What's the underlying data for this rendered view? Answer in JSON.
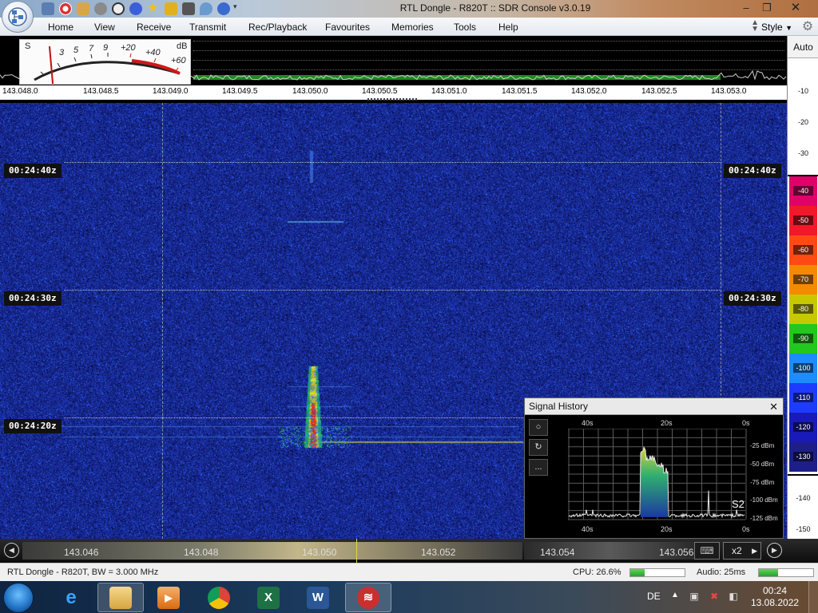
{
  "window": {
    "title": "RTL Dongle - R820T :: SDR Console v3.0.19",
    "minimize_icon": "minimize-icon",
    "maximize_icon": "maximize-icon",
    "close_icon": "close-icon"
  },
  "quick_access": [
    "home-icon",
    "lifebuoy-icon",
    "folder-icon",
    "play-icon",
    "play-icon",
    "stop-icon",
    "add-icon",
    "star-icon",
    "lock-icon",
    "camera-icon",
    "drop-icon",
    "undo-icon",
    "customize-icon"
  ],
  "ribbon": {
    "tabs": [
      "Home",
      "View",
      "Receive",
      "Transmit",
      "Rec/Playback",
      "Favourites",
      "Memories",
      "Tools",
      "Help"
    ],
    "style_label": "Style"
  },
  "smeter": {
    "s_label": "S",
    "db_label": "dB",
    "scale_s": [
      "3",
      "5",
      "7",
      "9"
    ],
    "scale_plus": [
      "+20",
      "+40",
      "+60"
    ],
    "needle_s": 1.5
  },
  "freq_top": {
    "ticks": [
      "143.048.0",
      "143.048.5",
      "143.049.0",
      "143.049.5",
      "143.050.0",
      "143.050.5",
      "143.051.0",
      "143.051.5",
      "143.052.0",
      "143.052.5",
      "143.053.0"
    ]
  },
  "waterfall": {
    "timestamps": [
      "00:24:40z",
      "00:24:30z",
      "00:24:20z"
    ]
  },
  "db_scale": {
    "auto_label": "Auto",
    "labels": [
      "-10",
      "-20",
      "-30",
      "-40",
      "-50",
      "-60",
      "-70",
      "-80",
      "-90",
      "-100",
      "-110",
      "-120",
      "-130",
      "-140",
      "-150"
    ],
    "colors": {
      "-40": "#e0006a",
      "-50": "#f0182a",
      "-60": "#ff4a14",
      "-70": "#f58a00",
      "-80": "#c8c800",
      "-90": "#22c81e",
      "-100": "#1c8cff",
      "-110": "#1e3cff",
      "-120": "#1a1ab8",
      "-130": "#1e1e8a"
    }
  },
  "signal_history": {
    "title": "Signal History",
    "x_labels_top": [
      "40s",
      "20s",
      "0s"
    ],
    "x_labels_bottom": [
      "40s",
      "20s",
      "0s"
    ],
    "y_labels": [
      "-25 dBm",
      "-50 dBm",
      "-75 dBm",
      "-100 dBm",
      "-125 dBm"
    ],
    "s_reading": "S2",
    "buttons": [
      "record-icon",
      "reset-icon",
      "more-icon"
    ],
    "more_label": "..."
  },
  "bottom_scale": {
    "ticks": [
      "143.046",
      "143.048",
      "143.050",
      "143.052",
      "143.054",
      "143.056"
    ],
    "zoom": "x2"
  },
  "status": {
    "left": "RTL Dongle - R820T, BW = 3.000 MHz",
    "cpu": "CPU: 26.6%",
    "cpu_fraction": 0.266,
    "audio": "Audio: 25ms",
    "audio_fraction": 0.35
  },
  "taskbar": {
    "apps": [
      "internet-explorer-icon",
      "file-explorer-icon",
      "media-player-icon",
      "chrome-icon",
      "excel-icon",
      "word-icon",
      "sdr-console-icon"
    ],
    "lang": "DE",
    "time": "00:24",
    "date": "13.08.2022"
  },
  "colors": {
    "waterfall_bg": "#0c1a6e",
    "signal_core": "#ff2a10",
    "signal_mid": "#f0e020",
    "signal_outer": "#20c848"
  }
}
